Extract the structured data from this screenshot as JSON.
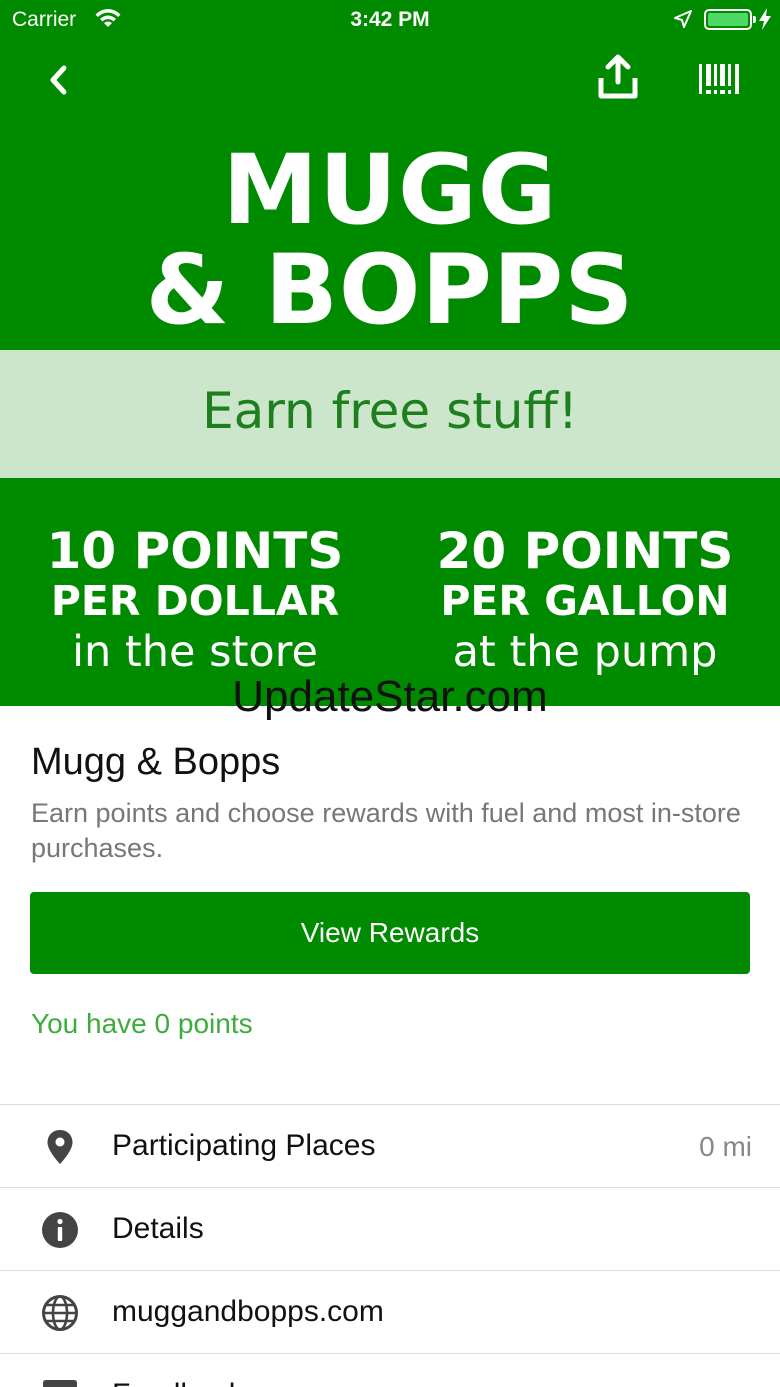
{
  "status": {
    "carrier": "Carrier",
    "time": "3:42 PM"
  },
  "brand": {
    "logo_line1": "MUGG",
    "logo_line2": "& BOPPS",
    "tagline": "Earn free stuff!"
  },
  "promo": {
    "left": {
      "big": "10 POINTS",
      "mid": "PER DOLLAR",
      "small": "in the store"
    },
    "right": {
      "big": "20 POINTS",
      "mid": "PER GALLON",
      "small": "at the pump"
    }
  },
  "watermark": "UpdateStar.com",
  "info": {
    "title": "Mugg & Bopps",
    "description": "Earn points and choose rewards with fuel and most in-store purchases."
  },
  "actions": {
    "view_rewards": "View Rewards"
  },
  "points_status": "You have 0 points",
  "list": [
    {
      "label": "Participating Places",
      "meta": "0 mi",
      "icon": "location-pin-icon"
    },
    {
      "label": "Details",
      "icon": "info-icon"
    },
    {
      "label": "muggandbopps.com",
      "icon": "globe-icon"
    },
    {
      "label": "Feedback",
      "icon": "chat-icon"
    }
  ],
  "colors": {
    "brand_green": "#008a00",
    "banner_green": "#cce6cc",
    "points_text": "#3cad3c"
  }
}
